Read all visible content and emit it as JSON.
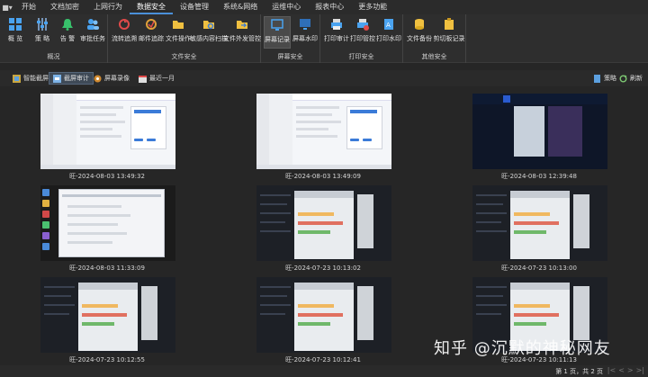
{
  "menu": {
    "items": [
      "开始",
      "文档加密",
      "上网行为",
      "数据安全",
      "设备管理",
      "系统&网络",
      "运维中心",
      "报表中心",
      "更多功能"
    ],
    "active_index": 3
  },
  "ribbon": {
    "groups": [
      {
        "label": "概况",
        "buttons": [
          "概 览",
          "策 略",
          "告 警",
          "审批任务"
        ]
      },
      {
        "label": "文件安全",
        "buttons": [
          "流转追溯",
          "邮件追踪",
          "文件操作",
          "敏感内容扫描",
          "文件外发管控"
        ]
      },
      {
        "label": "屏幕安全",
        "buttons": [
          "屏幕记录",
          "屏幕水印"
        ]
      },
      {
        "label": "打印安全",
        "buttons": [
          "打印审计",
          "打印管控",
          "打印水印"
        ]
      },
      {
        "label": "其他安全",
        "buttons": [
          "文件备份",
          "剪切板记录"
        ]
      }
    ],
    "selected_button": "屏幕记录"
  },
  "toolbar": {
    "items": [
      "智能截屏",
      "截屏审计",
      "屏幕录像",
      "最近一月"
    ],
    "selected": "截屏审计",
    "right": [
      "策略",
      "刷新"
    ]
  },
  "screenshots": [
    {
      "caption": "旺-2024-08-03 13:49:32",
      "style": "light"
    },
    {
      "caption": "旺-2024-08-03 13:49:09",
      "style": "light"
    },
    {
      "caption": "旺-2024-08-03 12:39:48",
      "style": "video"
    },
    {
      "caption": "旺-2024-08-03 11:33:09",
      "style": "blue"
    },
    {
      "caption": "旺-2024-07-23 10:13:02",
      "style": "dark"
    },
    {
      "caption": "旺-2024-07-23 10:13:00",
      "style": "dark"
    },
    {
      "caption": "旺-2024-07-23 10:12:55",
      "style": "dark"
    },
    {
      "caption": "旺-2024-07-23 10:12:41",
      "style": "dark"
    },
    {
      "caption": "旺-2024-07-23 10:11:13",
      "style": "dark"
    }
  ],
  "status": {
    "page": "第 1 页，共 2 页"
  },
  "watermark": "知乎 @沉默的神秘网友",
  "colors": {
    "accent": "#4a90d9",
    "background": "#262626",
    "ribbon": "#2e2e2e"
  }
}
